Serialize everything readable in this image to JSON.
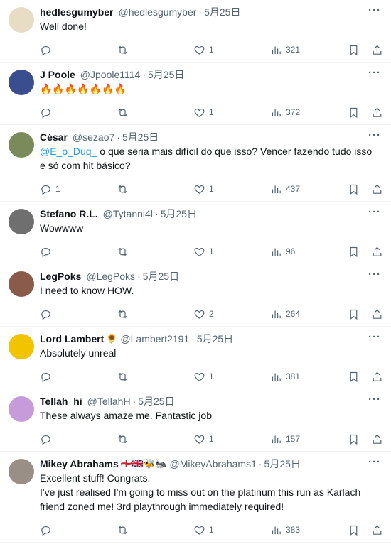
{
  "tweets": [
    {
      "name": "hedlesgumyber",
      "extra": "",
      "handle": "@hedlesgumyber",
      "date": "5月25日",
      "text_pre": "",
      "mention": "",
      "text": "Well done!",
      "replies": "",
      "likes": "1",
      "views": "321",
      "avatar_color": "#e7dcc4"
    },
    {
      "name": "J Poole",
      "extra": "",
      "handle": "@Jpoole1114",
      "date": "5月25日",
      "text_pre": "",
      "mention": "",
      "text": "🔥🔥🔥🔥🔥🔥🔥",
      "replies": "",
      "likes": "1",
      "views": "372",
      "avatar_color": "#3a4d8f"
    },
    {
      "name": "César",
      "extra": "",
      "handle": "@sezao7",
      "date": "5月25日",
      "text_pre": "",
      "mention": "@E_o_Duq_",
      "text": " o que seria mais difícil do que isso? Vencer fazendo tudo isso e só com hit básico?",
      "replies": "1",
      "likes": "1",
      "views": "437",
      "avatar_color": "#7a8a5a"
    },
    {
      "name": "Stefano R.L.",
      "extra": "",
      "handle": "@Tytanni4l",
      "date": "5月25日",
      "text_pre": "",
      "mention": "",
      "text": "Wowwww",
      "replies": "",
      "likes": "1",
      "views": "96",
      "avatar_color": "#6f6f6f"
    },
    {
      "name": "LegPoks",
      "extra": "",
      "handle": "@LegPoks",
      "date": "5月25日",
      "text_pre": "",
      "mention": "",
      "text": "I need to know HOW.",
      "replies": "",
      "likes": "2",
      "views": "264",
      "avatar_color": "#8a5a4a"
    },
    {
      "name": "Lord Lambert",
      "extra": "🌻",
      "handle": "@Lambert2191",
      "date": "5月25日",
      "text_pre": "",
      "mention": "",
      "text": "Absolutely unreal",
      "replies": "",
      "likes": "1",
      "views": "381",
      "avatar_color": "#f2c400"
    },
    {
      "name": "Tellah_hi",
      "extra": "",
      "handle": "@TellahH",
      "date": "5月25日",
      "text_pre": "",
      "mention": "",
      "text": "These always amaze me. Fantastic job",
      "replies": "",
      "likes": "1",
      "views": "157",
      "avatar_color": "#c79ad9"
    },
    {
      "name": "Mikey Abrahams",
      "extra": "🏴󠁧󠁢󠁥󠁮󠁧󠁿🇬🇧🐝🐜",
      "handle": "@MikeyAbrahams1",
      "date": "5月25日",
      "text_pre": "",
      "mention": "",
      "text": "Excellent stuff! Congrats.\nI've just realised I'm going to miss out on the platinum this run as Karlach friend zoned me! 3rd playthrough immediately required!",
      "replies": "",
      "likes": "1",
      "views": "383",
      "avatar_color": "#9a8f86"
    }
  ]
}
